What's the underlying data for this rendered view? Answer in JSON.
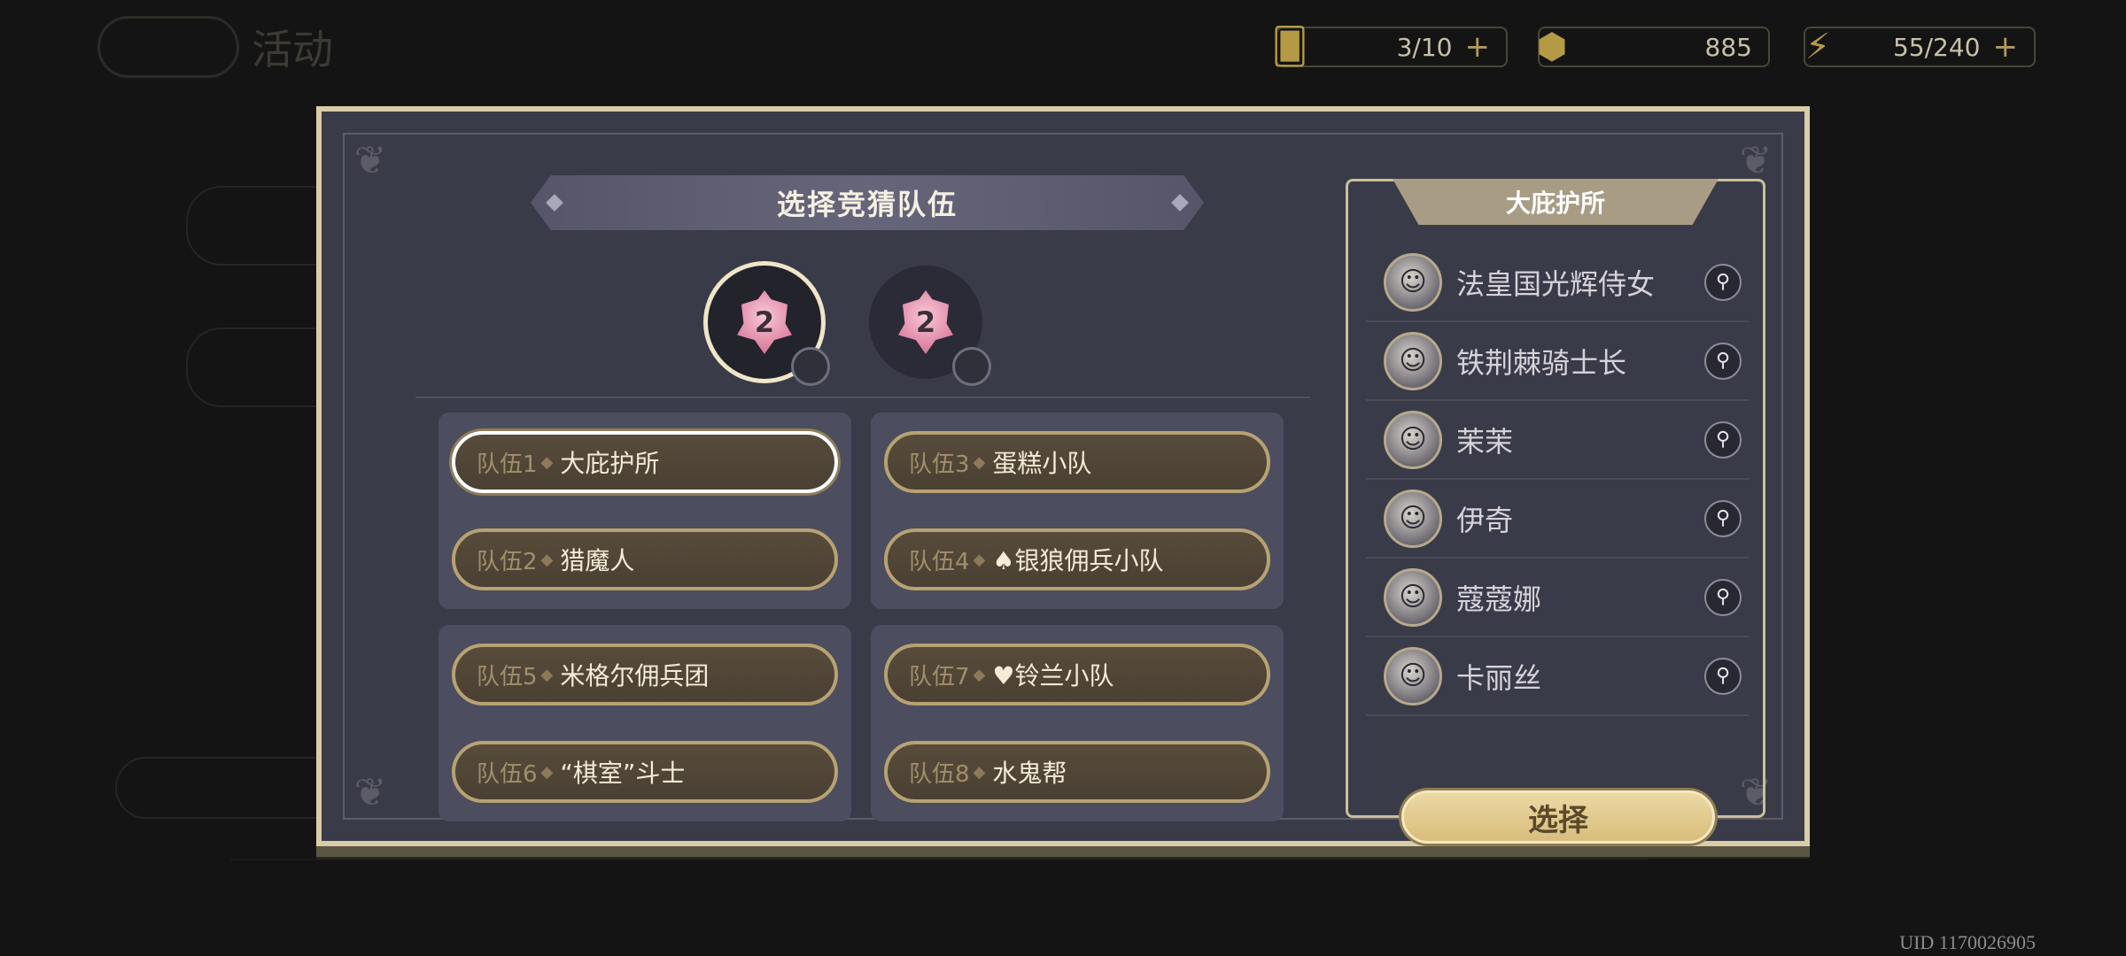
{
  "resources": [
    {
      "icon": "ticket-icon",
      "value": "3/10",
      "has_plus": true
    },
    {
      "icon": "coin-icon",
      "value": "885",
      "has_plus": false
    },
    {
      "icon": "lightning-icon",
      "value": "55/240",
      "has_plus": true
    }
  ],
  "background": {
    "title": "活动"
  },
  "dialog": {
    "title": "选择竞猜队伍",
    "emblems": [
      {
        "value": "2",
        "selected": true
      },
      {
        "value": "2",
        "selected": false
      }
    ],
    "teams": [
      {
        "num": "队伍1",
        "name": "大庇护所",
        "selected": true
      },
      {
        "num": "队伍2",
        "name": "猎魔人",
        "selected": false
      },
      {
        "num": "队伍3",
        "name": "蛋糕小队",
        "selected": false
      },
      {
        "num": "队伍4",
        "name": "♠银狼佣兵小队",
        "selected": false
      },
      {
        "num": "队伍5",
        "name": "米格尔佣兵团",
        "selected": false
      },
      {
        "num": "队伍6",
        "name": "“棋室”斗士",
        "selected": false
      },
      {
        "num": "队伍7",
        "name": "♥铃兰小队",
        "selected": false
      },
      {
        "num": "队伍8",
        "name": "水鬼帮",
        "selected": false
      }
    ],
    "detail": {
      "header": "大庇护所",
      "members": [
        {
          "name": "法皇国光辉侍女"
        },
        {
          "name": "铁荆棘骑士长"
        },
        {
          "name": "茉茉"
        },
        {
          "name": "伊奇"
        },
        {
          "name": "蔻蔻娜"
        },
        {
          "name": "卡丽丝"
        }
      ],
      "select_label": "选择"
    }
  },
  "uid": "UID 1170026905",
  "colors": {
    "panel": "#3a3b49",
    "frame": "#d9cda8",
    "team_button": "#4a4033",
    "team_border": "#b8a272",
    "select_button": "#dcc283"
  }
}
